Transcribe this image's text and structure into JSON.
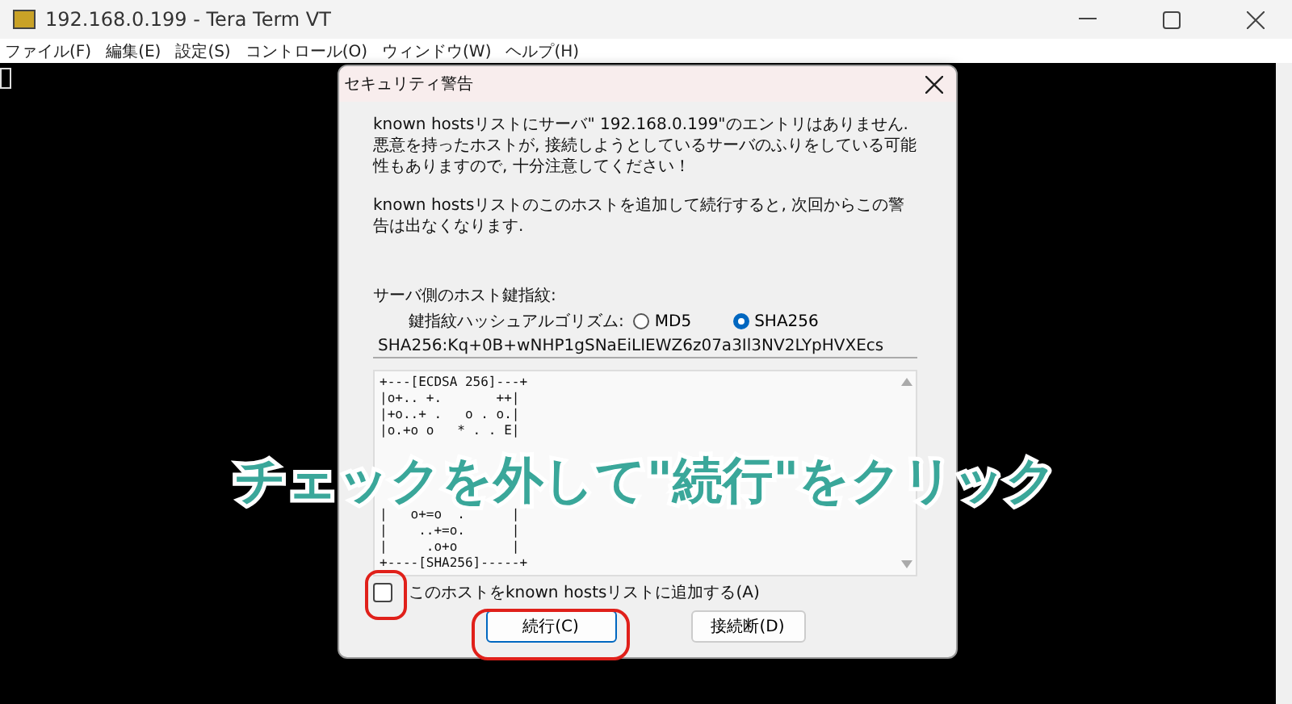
{
  "window": {
    "title": "192.168.0.199 - Tera Term VT"
  },
  "menu": [
    "ファイル(F)",
    "編集(E)",
    "設定(S)",
    "コントロール(O)",
    "ウィンドウ(W)",
    "ヘルプ(H)"
  ],
  "dialog": {
    "title": "セキュリティ警告",
    "messages": [
      "known hostsリストにサーバ\" 192.168.0.199\"のエントリはありません. 悪意を持ったホストが, 接続しようとしているサーバのふりをしている可能性もありますので, 十分注意してください！",
      "known hostsリストのこのホストを追加して続行すると, 次回からこの警告は出なくなります."
    ],
    "fingerprint_label": "サーバ側のホスト鍵指紋:",
    "algorithm_label": "鍵指紋ハッシュアルゴリズム:",
    "algorithms": [
      {
        "label": "MD5",
        "selected": false
      },
      {
        "label": "SHA256",
        "selected": true
      }
    ],
    "fingerprint": "SHA256:Kq+0B+wNHP1gSNaEiLIEWZ6z07a3Il3NV2LYpHVXEcs",
    "art_top": [
      "+---[ECDSA 256]---+",
      "|o+.. +.       ++|",
      "|+o..+ .   o . o.|",
      "|o.+o o   * . . E|"
    ],
    "art_bottom": [
      "|   o+=o  .      |",
      "|    ..+=o.      |",
      "|     .o+o       |",
      "+----[SHA256]-----+"
    ],
    "add_host": {
      "label": "このホストをknown hostsリストに追加する(A)",
      "checked": false
    },
    "buttons": [
      {
        "label": "続行(C)",
        "default": true
      },
      {
        "label": "接続断(D)",
        "default": false
      }
    ]
  },
  "annotation": "チェックを外して\"続行\"をクリック"
}
